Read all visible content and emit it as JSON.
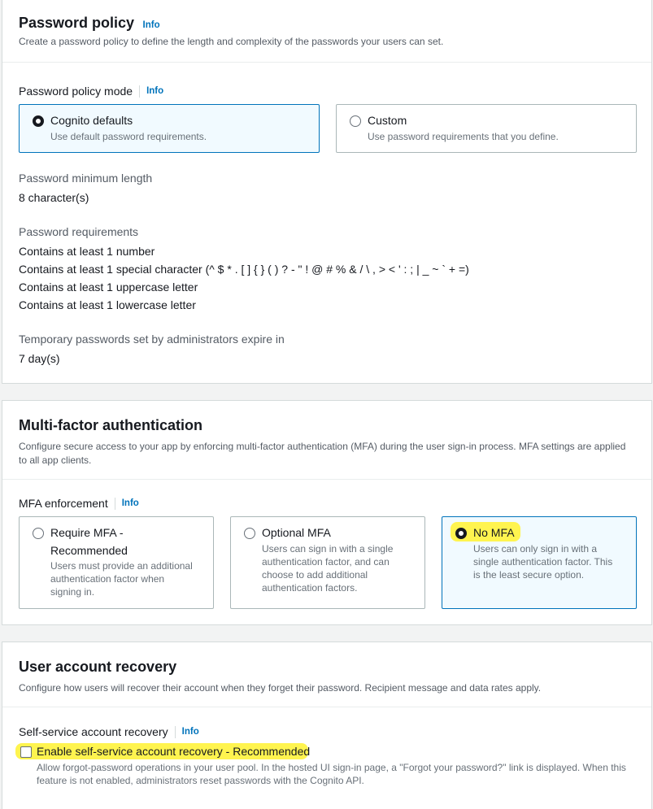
{
  "password_policy": {
    "title": "Password policy",
    "info": "Info",
    "description": "Create a password policy to define the length and complexity of the passwords your users can set.",
    "mode_label": "Password policy mode",
    "mode_info": "Info",
    "options": [
      {
        "title": "Cognito defaults",
        "description": "Use default password requirements.",
        "selected": true
      },
      {
        "title": "Custom",
        "description": "Use password requirements that you define.",
        "selected": false
      }
    ],
    "min_length_label": "Password minimum length",
    "min_length_value": "8 character(s)",
    "requirements_label": "Password requirements",
    "requirements": [
      "Contains at least 1 number",
      "Contains at least 1 special character (^ $ * . [ ] { } ( ) ? - \" ! @ # % & / \\ , > < ' : ; | _ ~ ` + =)",
      "Contains at least 1 uppercase letter",
      "Contains at least 1 lowercase letter"
    ],
    "temp_expire_label": "Temporary passwords set by administrators expire in",
    "temp_expire_value": "7 day(s)"
  },
  "mfa": {
    "title": "Multi-factor authentication",
    "description": "Configure secure access to your app by enforcing multi-factor authentication (MFA) during the user sign-in process. MFA settings are applied to all app clients.",
    "enforcement_label": "MFA enforcement",
    "enforcement_info": "Info",
    "options": [
      {
        "title_line1": "Require MFA -",
        "title_line2": "Recommended",
        "desc_lines": [
          "Users must provide an additional",
          "authentication factor when",
          "signing in."
        ],
        "selected": false
      },
      {
        "title_line1": "Optional MFA",
        "title_line2": "",
        "desc_lines": [
          "Users can sign in with a single",
          "authentication factor, and can",
          "choose to add additional",
          "authentication factors."
        ],
        "selected": false
      },
      {
        "title_line1": "No MFA",
        "title_line2": "",
        "desc_lines": [
          "Users can only sign in with a",
          "single authentication factor. This",
          "is the least secure option."
        ],
        "selected": true
      }
    ]
  },
  "recovery": {
    "title": "User account recovery",
    "description": "Configure how users will recover their account when they forget their password. Recipient message and data rates apply.",
    "self_service_label": "Self-service account recovery",
    "self_service_info": "Info",
    "checkbox_label": "Enable self-service account recovery - Recommended",
    "checkbox_checked": false,
    "checkbox_desc": "Allow forgot-password operations in your user pool. In the hosted UI sign-in page, a \"Forgot your password?\" link is displayed. When this feature is not enabled, administrators reset passwords with the Cognito API."
  },
  "colors": {
    "accent": "#0073bb",
    "highlight": "#fff44f",
    "selected_tile_bg": "#f1faff"
  }
}
